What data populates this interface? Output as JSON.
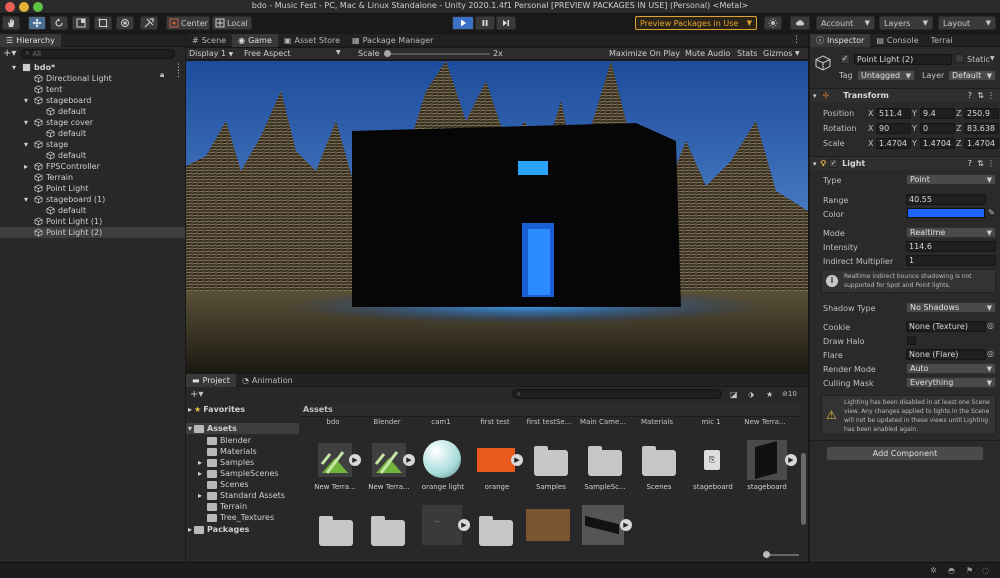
{
  "window": {
    "title": "bdo - Music Fest - PC, Mac & Linux Standalone - Unity 2020.1.4f1 Personal [PREVIEW PACKAGES IN USE] (Personal) <Metal>"
  },
  "toolbar": {
    "center_label": "Center",
    "local_label": "Local",
    "preview_packages_label": "Preview Packages in Use",
    "account_label": "Account",
    "layers_label": "Layers",
    "layout_label": "Layout"
  },
  "hierarchy": {
    "tab_label": "Hierarchy",
    "search_placeholder": "All",
    "items": [
      {
        "label": "bdo*"
      },
      {
        "label": "Directional Light"
      },
      {
        "label": "tent"
      },
      {
        "label": "stageboard"
      },
      {
        "label": "default"
      },
      {
        "label": "stage cover"
      },
      {
        "label": "default"
      },
      {
        "label": "stage"
      },
      {
        "label": "default"
      },
      {
        "label": "FPSController"
      },
      {
        "label": "Terrain"
      },
      {
        "label": "Point Light"
      },
      {
        "label": "stageboard (1)"
      },
      {
        "label": "default"
      },
      {
        "label": "Point Light (1)"
      },
      {
        "label": "Point Light (2)"
      }
    ]
  },
  "center_tabs": {
    "scene": "Scene",
    "game": "Game",
    "asset_store": "Asset Store",
    "package_manager": "Package Manager"
  },
  "game_bar": {
    "display": "Display 1",
    "aspect": "Free Aspect",
    "scale_label": "Scale",
    "scale_value": "2x",
    "maximize": "Maximize On Play",
    "mute": "Mute Audio",
    "stats": "Stats",
    "gizmos": "Gizmos"
  },
  "project": {
    "tab_project": "Project",
    "tab_animation": "Animation",
    "badge_count": "10",
    "tree": {
      "favorites": "Favorites",
      "assets": "Assets",
      "children": [
        "Blender",
        "Materials",
        "Samples",
        "SampleScenes",
        "Scenes",
        "Standard Assets",
        "Terrain",
        "Tree_Textures"
      ],
      "packages": "Packages"
    },
    "breadcrumb": "Assets",
    "top_labels": [
      "bdo",
      "Blender",
      "cam1",
      "first test",
      "first testSe...",
      "Main Came...",
      "Materials",
      "mic 1",
      "New Terra..."
    ],
    "assets": [
      {
        "label": "New Terra..."
      },
      {
        "label": "New Terra..."
      },
      {
        "label": "orange light"
      },
      {
        "label": "orange"
      },
      {
        "label": "Samples"
      },
      {
        "label": "SampleSc..."
      },
      {
        "label": "Scenes"
      },
      {
        "label": "stageboard"
      },
      {
        "label": "stageboard"
      }
    ]
  },
  "inspector": {
    "tab_inspector": "Inspector",
    "tab_console": "Console",
    "tab_terrain": "Terrai",
    "object_name": "Point Light (2)",
    "static_label": "Static",
    "tag_label": "Tag",
    "tag_value": "Untagged",
    "layer_label": "Layer",
    "layer_value": "Default",
    "transform": {
      "title": "Transform",
      "position_label": "Position",
      "rotation_label": "Rotation",
      "scale_label": "Scale",
      "position": [
        "511.4",
        "9.4",
        "250.9"
      ],
      "rotation": [
        "90",
        "0",
        "83.638"
      ],
      "scale": [
        "1.4704",
        "1.4704",
        "1.4704"
      ]
    },
    "light": {
      "title": "Light",
      "type_label": "Type",
      "type_value": "Point",
      "range_label": "Range",
      "range_value": "40.55",
      "color_label": "Color",
      "color_hex": "#1f66ff",
      "mode_label": "Mode",
      "mode_value": "Realtime",
      "intensity_label": "Intensity",
      "intensity_value": "114.6",
      "indirect_label": "Indirect Multiplier",
      "indirect_value": "1",
      "info_text": "Realtime indirect bounce shadowing is not supported for Spot and Point lights.",
      "shadow_label": "Shadow Type",
      "shadow_value": "No Shadows",
      "cookie_label": "Cookie",
      "cookie_value": "None (Texture)",
      "halo_label": "Draw Halo",
      "flare_label": "Flare",
      "flare_value": "None (Flare)",
      "render_label": "Render Mode",
      "render_value": "Auto",
      "culling_label": "Culling Mask",
      "culling_value": "Everything",
      "warning_text": "Lighting has been disabled in at least one Scene view. Any changes applied to lights in the Scene will not be updated in these views until Lighting has been enabled again."
    },
    "add_component": "Add Component"
  },
  "colors": {
    "accent_blue": "#2a5f9f",
    "play_blue": "#3b72c8",
    "preview_orange": "#e0a436",
    "light_blue": "#1f66ff"
  }
}
